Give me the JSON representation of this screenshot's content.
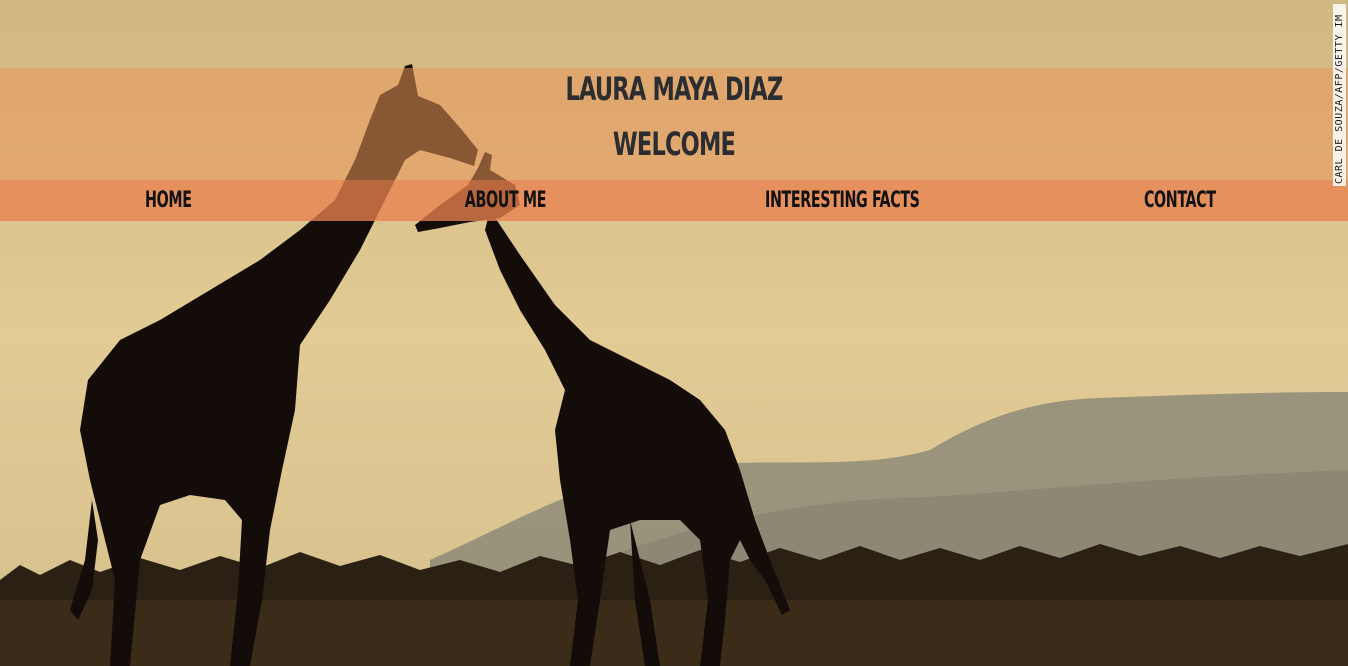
{
  "header": {
    "site_name": "LAURA MAYA DIAZ",
    "welcome": "WELCOME"
  },
  "nav": {
    "items": [
      {
        "label": "HOME"
      },
      {
        "label": "ABOUT ME"
      },
      {
        "label": "INTERESTING FACTS"
      },
      {
        "label": "CONTACT"
      }
    ]
  },
  "hero": {
    "image_credit": "CARL DE SOUZA/AFP/GETTY IM",
    "accent_color": "#e8824f",
    "band_color": "#e0a06a"
  }
}
